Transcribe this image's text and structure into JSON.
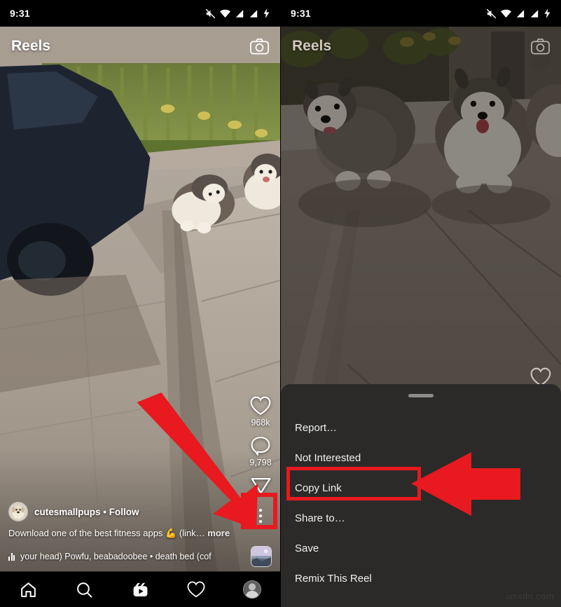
{
  "status_bar": {
    "time": "9:31",
    "icons": [
      "mute-icon",
      "wifi-icon",
      "signal-icon",
      "signal-icon-2",
      "battery-charging-icon"
    ]
  },
  "colors": {
    "annotation_red": "#e8191f",
    "sheet_background": "#2b2a29",
    "nav_background": "#000000",
    "text_primary": "#ffffff",
    "watermark": "#3a3a3a"
  },
  "left_panel": {
    "header": {
      "title": "Reels",
      "camera_icon": "camera-icon"
    },
    "actions": {
      "like": {
        "icon": "heart-icon",
        "count": "968k"
      },
      "comment": {
        "icon": "comment-icon",
        "count": "9,798"
      },
      "share": {
        "icon": "send-icon"
      },
      "more": {
        "icon": "three-dots-icon"
      }
    },
    "post": {
      "username": "cutesmallpups",
      "separator": "•",
      "follow_label": "Follow",
      "caption": "Download one of the best fitness apps 💪 (link…",
      "caption_more": " more",
      "audio_text": "your head)   Powfu, beabadoobee • death bed (cof",
      "audio_icon": "audio-bars-icon",
      "album_art": "album-art-thumbnail"
    },
    "bottom_nav": [
      {
        "name": "home",
        "icon": "home-icon"
      },
      {
        "name": "search",
        "icon": "search-icon"
      },
      {
        "name": "reels",
        "icon": "reels-icon"
      },
      {
        "name": "activity",
        "icon": "heart-icon"
      },
      {
        "name": "profile",
        "icon": "profile-avatar-icon"
      }
    ]
  },
  "right_panel": {
    "header": {
      "title": "Reels",
      "camera_icon": "camera-icon"
    },
    "actions": {
      "like": {
        "icon": "heart-icon"
      }
    },
    "sheet": {
      "handle": "drag-handle",
      "items": [
        {
          "label": "Report…",
          "highlighted": false
        },
        {
          "label": "Not Interested",
          "highlighted": false
        },
        {
          "label": "Copy Link",
          "highlighted": true
        },
        {
          "label": "Share to…",
          "highlighted": false
        },
        {
          "label": "Save",
          "highlighted": false
        },
        {
          "label": "Remix This Reel",
          "highlighted": false
        }
      ]
    }
  },
  "annotations": {
    "left_arrow": "red-arrow-pointing-down-right-to-more-button",
    "right_arrow": "red-arrow-pointing-left-to-copy-link",
    "left_highlight": "red-box-around-three-dots-button",
    "right_highlight": "red-box-around-copy-link"
  },
  "watermark": "wsxdn.com"
}
